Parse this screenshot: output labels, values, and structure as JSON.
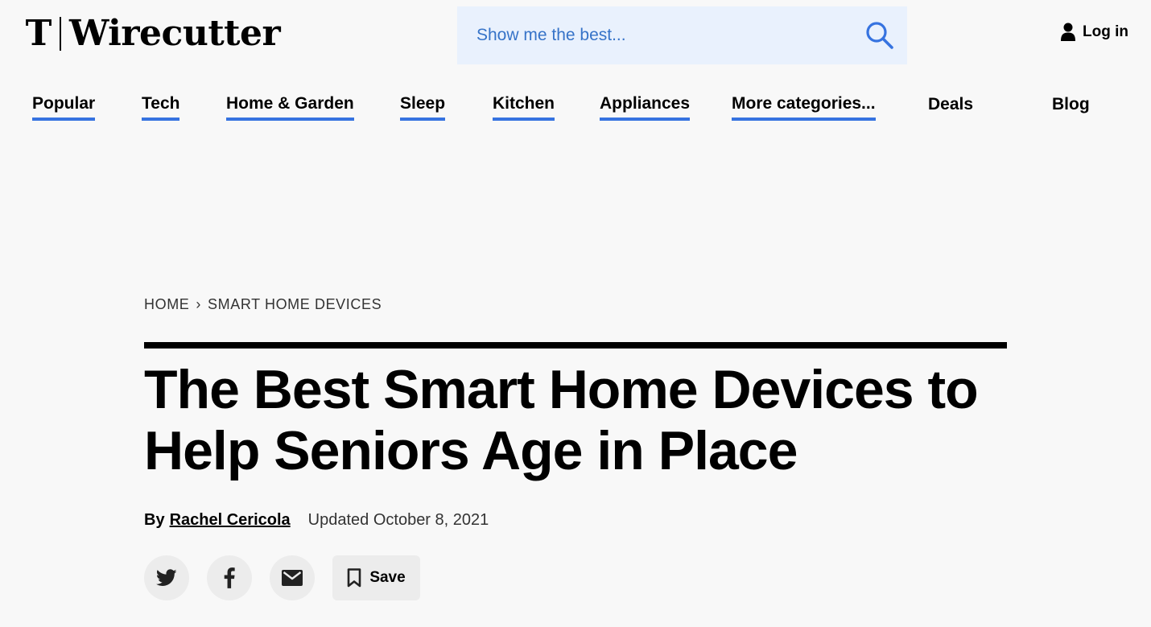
{
  "header": {
    "logo_mark": "T",
    "logo_text": "Wirecutter",
    "search_placeholder": "Show me the best...",
    "login_label": "Log in"
  },
  "nav": {
    "items": [
      {
        "label": "Popular"
      },
      {
        "label": "Tech"
      },
      {
        "label": "Home & Garden"
      },
      {
        "label": "Sleep"
      },
      {
        "label": "Kitchen"
      },
      {
        "label": "Appliances"
      },
      {
        "label": "More categories..."
      },
      {
        "label": "Deals"
      },
      {
        "label": "Blog"
      }
    ]
  },
  "article": {
    "breadcrumb": [
      "HOME",
      "SMART HOME DEVICES"
    ],
    "breadcrumb_separator": "›",
    "headline": "The Best Smart Home Devices to Help Seniors Age in Place",
    "byline_prefix": "By",
    "author": "Rachel Cericola",
    "updated": "Updated October 8, 2021",
    "save_label": "Save"
  },
  "colors": {
    "accent": "#3673e0",
    "search_bg": "#e9f1fd",
    "page_bg": "#f8f8f8",
    "button_bg": "#ececec"
  },
  "icons": [
    "search-icon",
    "person-icon",
    "twitter-icon",
    "facebook-icon",
    "mail-icon",
    "bookmark-icon"
  ]
}
